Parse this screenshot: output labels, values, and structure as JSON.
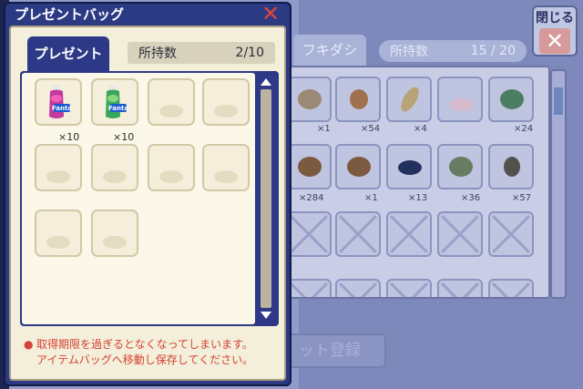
{
  "present_window": {
    "title": "プレゼントバッグ",
    "close_symbol": "✕",
    "tab_label": "プレゼント",
    "count_label": "所持数",
    "count_value": "2/10",
    "items": [
      {
        "icon": "fanta-grape-can-icon",
        "quantity": "×10",
        "color": "#c03aa0"
      },
      {
        "icon": "fanta-melon-can-icon",
        "quantity": "×10",
        "color": "#3aa65a"
      }
    ],
    "empty_slots": 8,
    "notice_line1": "取得期限を過ぎるとなくなってしまいます。",
    "notice_line2": "アイテムバッグへ移動し保存してください。"
  },
  "background_window": {
    "close_label": "閉じる",
    "tab_label": "フキダシ",
    "count_label": "所持数",
    "count_value": "15 / 20",
    "row1_quantities": [
      "×1",
      "×54",
      "×4",
      "",
      "×24"
    ],
    "row2_quantities": [
      "×284",
      "×1",
      "×13",
      "×36",
      "×57"
    ],
    "register_button": "ット登録"
  },
  "colors": {
    "window_blue": "#2c3a84",
    "panel_cream": "#f3efda",
    "notice_red": "#d54236",
    "close_red": "#e0453b"
  }
}
